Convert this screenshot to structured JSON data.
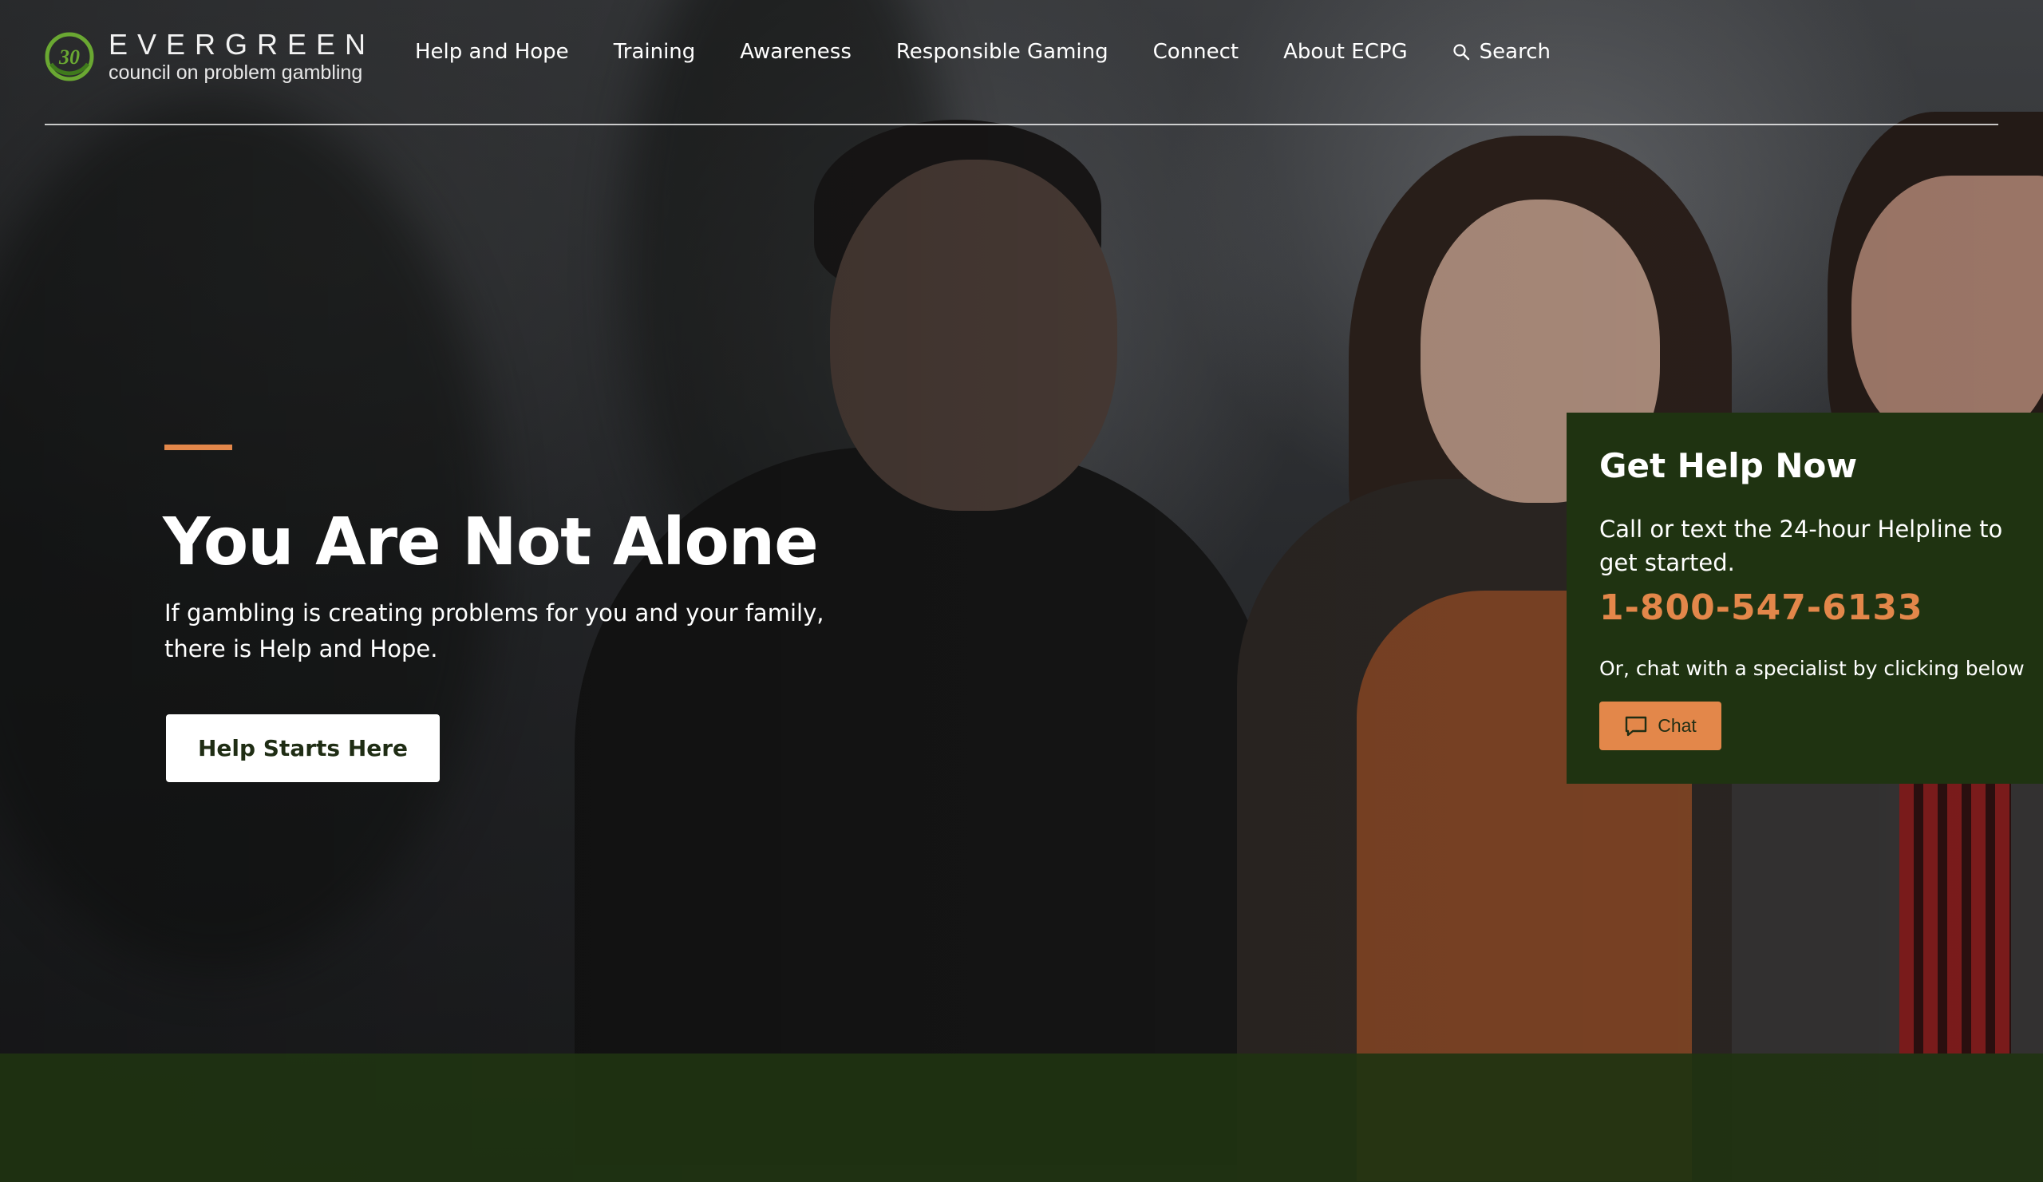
{
  "brand": {
    "logo_mark_text": "30",
    "name": "EVERGREEN",
    "tagline": "council on problem gambling"
  },
  "nav": {
    "items": [
      {
        "label": "Help and Hope"
      },
      {
        "label": "Training"
      },
      {
        "label": "Awareness"
      },
      {
        "label": "Responsible Gaming"
      },
      {
        "label": "Connect"
      },
      {
        "label": "About ECPG"
      }
    ],
    "search_label": "Search"
  },
  "hero": {
    "title": "You Are Not Alone",
    "text": "If gambling is creating problems for you and your family, there is Help and Hope.",
    "button_label": "Help Starts Here"
  },
  "help_panel": {
    "title": "Get Help Now",
    "text": "Call or text the 24-hour Helpline to get started.",
    "phone": "1-800-547-6133",
    "chat_prompt": "Or, chat with a specialist by clicking below",
    "chat_button_label": "Chat"
  },
  "colors": {
    "accent": "#e3874a",
    "panel_green": "#1f3311",
    "logo_green": "#6aa832"
  }
}
